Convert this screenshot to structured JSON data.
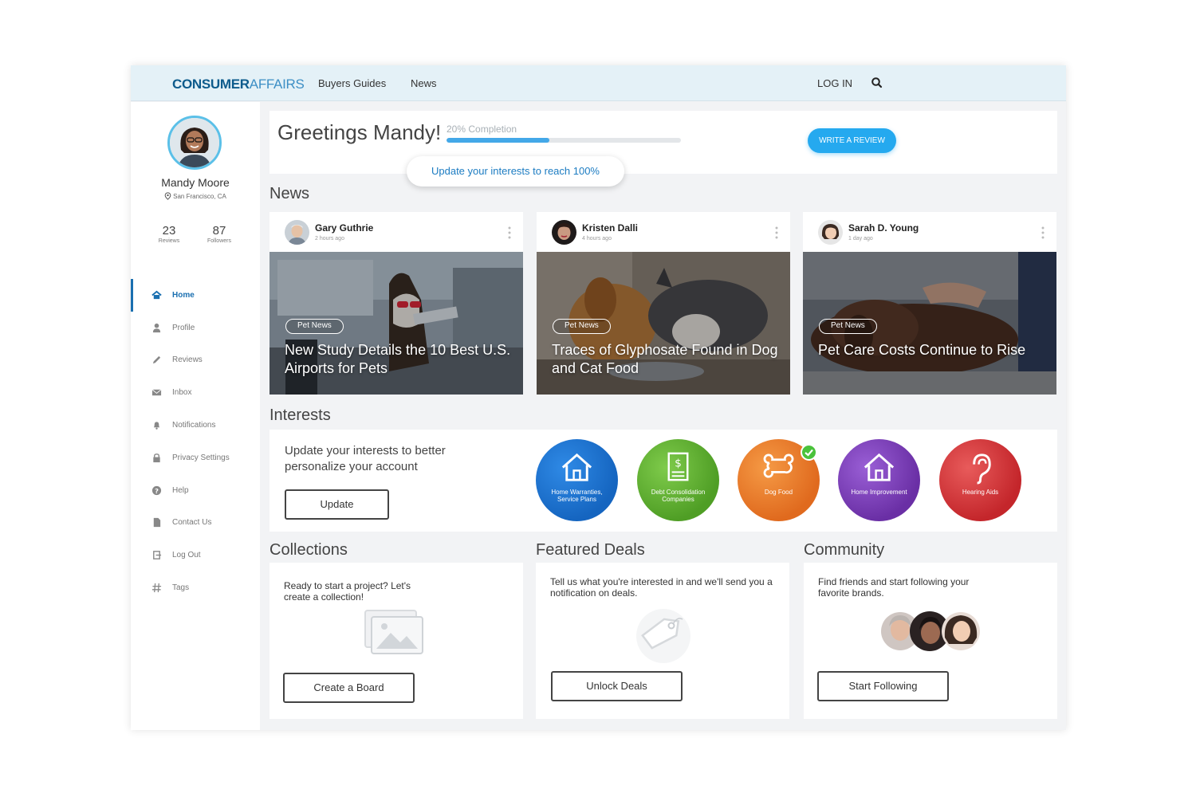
{
  "header": {
    "logo_bold": "CONSUMER",
    "logo_light": "AFFAIRS",
    "nav": [
      "Buyers Guides",
      "News"
    ],
    "login": "LOG IN"
  },
  "profile": {
    "name": "Mandy Moore",
    "location": "San Francisco, CA",
    "reviews_count": "23",
    "reviews_label": "Reviews",
    "followers_count": "87",
    "followers_label": "Followers"
  },
  "sidebar": {
    "items": [
      {
        "label": "Home",
        "icon": "home-icon",
        "active": true
      },
      {
        "label": "Profile",
        "icon": "user-icon"
      },
      {
        "label": "Reviews",
        "icon": "pencil-icon"
      },
      {
        "label": "Inbox",
        "icon": "mail-icon"
      },
      {
        "label": "Notifications",
        "icon": "bell-icon"
      },
      {
        "label": "Privacy Settings",
        "icon": "lock-icon"
      },
      {
        "label": "Help",
        "icon": "help-icon"
      },
      {
        "label": "Contact Us",
        "icon": "document-icon"
      },
      {
        "label": "Log Out",
        "icon": "logout-icon"
      },
      {
        "label": "Tags",
        "icon": "hash-icon"
      }
    ]
  },
  "greeting": {
    "title": "Greetings Mandy!",
    "completion_label": "20% Completion",
    "completion": 0.2,
    "write_review": "WRITE A REVIEW",
    "tooltip": "Update your interests to reach 100%"
  },
  "news": {
    "title": "News",
    "cards": [
      {
        "author": "Gary Guthrie",
        "time": "2 hours ago",
        "tag": "Pet News",
        "title": "New Study Details the 10 Best U.S. Airports for Pets"
      },
      {
        "author": "Kristen Dalli",
        "time": "4 hours ago",
        "tag": "Pet News",
        "title": "Traces of Glyphosate Found in Dog and Cat Food"
      },
      {
        "author": "Sarah D. Young",
        "time": "1 day ago",
        "tag": "Pet News",
        "title": "Pet Care Costs Continue to Rise"
      }
    ]
  },
  "interests": {
    "title": "Interests",
    "text": "Update your interests to better personalize your account",
    "button": "Update",
    "items": [
      {
        "label": "Home Warranties, Service Plans",
        "color": "#1565c0",
        "icon": "house-icon",
        "selected": false
      },
      {
        "label": "Debt Consolidation Companies",
        "color": "#5aab2c",
        "icon": "debt-document-icon",
        "selected": false
      },
      {
        "label": "Dog Food",
        "color": "#e8742a",
        "icon": "bone-icon",
        "selected": true
      },
      {
        "label": "Home Improvement",
        "color": "#7b3fb5",
        "icon": "house-icon",
        "selected": false
      },
      {
        "label": "Hearing Aids",
        "color": "#d23a3a",
        "icon": "ear-icon",
        "selected": false
      }
    ]
  },
  "collections": {
    "title": "Collections",
    "text": "Ready to start a project? Let's create a collection!",
    "button": "Create a Board"
  },
  "deals": {
    "title": "Featured Deals",
    "text": "Tell us what you're interested in and we'll send you a notification on deals.",
    "button": "Unlock Deals"
  },
  "community": {
    "title": "Community",
    "text": "Find friends and start following your favorite brands.",
    "button": "Start Following"
  },
  "colors": {
    "accent": "#25a9ef",
    "brand_dark": "#0d5b8c",
    "topbar": "#e4f1f7"
  }
}
